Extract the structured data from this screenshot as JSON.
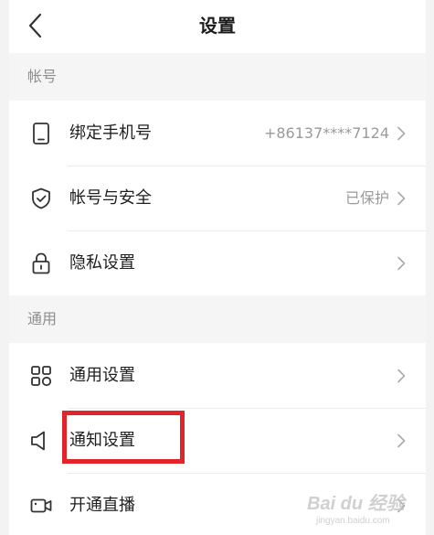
{
  "header": {
    "title": "设置"
  },
  "sections": [
    {
      "label": "帐号",
      "rows": [
        {
          "label": "绑定手机号",
          "value": "+86137****7124",
          "icon": "phone-icon"
        },
        {
          "label": "帐号与安全",
          "value": "已保护",
          "icon": "shield-icon"
        },
        {
          "label": "隐私设置",
          "value": "",
          "icon": "lock-icon"
        }
      ]
    },
    {
      "label": "通用",
      "rows": [
        {
          "label": "通用设置",
          "value": "",
          "icon": "grid-icon"
        },
        {
          "label": "通知设置",
          "value": "",
          "icon": "speaker-icon"
        },
        {
          "label": "开通直播",
          "value": "",
          "icon": "video-camera-icon"
        }
      ]
    }
  ],
  "colors": {
    "highlight": "#e0262b",
    "background": "#f5f5f5"
  },
  "watermark": {
    "main": "Bai du 经验",
    "sub": "jingyan.baidu.com"
  }
}
